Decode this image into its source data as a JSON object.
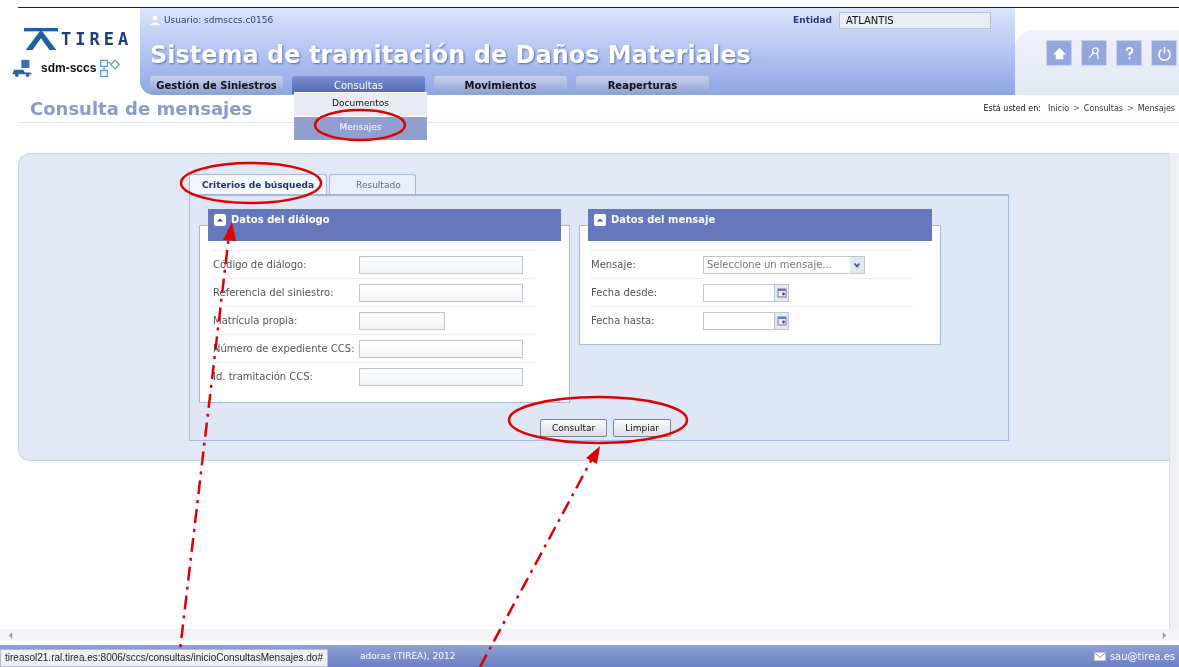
{
  "header": {
    "logo_text": "TIREA",
    "product": "sdm-sccs",
    "user_label": "Usuario: sdmsccs.c0156",
    "entity_label": "Entidad",
    "entity_value": "ATLANTIS",
    "app_title": "Sistema de tramitación de Daños Materiales"
  },
  "nav": [
    {
      "label": "Gestión de Siniestros",
      "selected": false
    },
    {
      "label": "Consultas",
      "selected": true
    },
    {
      "label": "Movimientos",
      "selected": false
    },
    {
      "label": "Reaperturas",
      "selected": false
    }
  ],
  "dropdown": [
    {
      "label": "Documentos",
      "selected": false
    },
    {
      "label": "Mensajes",
      "selected": true
    }
  ],
  "page_title": "Consulta de mensajes",
  "breadcrumb": {
    "label": "Está usted en:",
    "items": [
      {
        "label": "Inicio",
        "separator": ">"
      },
      {
        "label": "Consultas",
        "separator": ">"
      },
      {
        "label": "Mensajes"
      }
    ]
  },
  "tabs": [
    {
      "label": "Criterios de búsqueda",
      "selected": true
    },
    {
      "label": "Resultado",
      "selected": false
    }
  ],
  "sections": [
    {
      "title": "Datos del diálogo",
      "expanded": true,
      "fields": [
        {
          "label": "Código de diálogo:",
          "kind": "text"
        },
        {
          "label": "Referencia del siniestro:",
          "kind": "text"
        },
        {
          "label": "Matrícula propia:",
          "kind": "short"
        },
        {
          "label": "Número de expediente CCS:",
          "kind": "text"
        },
        {
          "label": "Id. tramitación CCS:",
          "kind": "text"
        }
      ]
    },
    {
      "title": "Datos del mensaje",
      "expanded": true,
      "fields": [
        {
          "label": "Mensaje:",
          "kind": "select",
          "placeholder": "Seleccione un mensaje..."
        },
        {
          "label": "Fecha desde:",
          "kind": "date"
        },
        {
          "label": "Fecha hasta:",
          "kind": "date"
        }
      ]
    }
  ],
  "buttons": [
    "Consultar",
    "Limpiar"
  ],
  "footer": {
    "text": "adoras (TIREA), 2012",
    "email": "sau@tirea.es"
  },
  "status_url": "tireasol21.ral.tirea.es:8006/sccs/consultas/inicioConsultasMensajes.do#"
}
